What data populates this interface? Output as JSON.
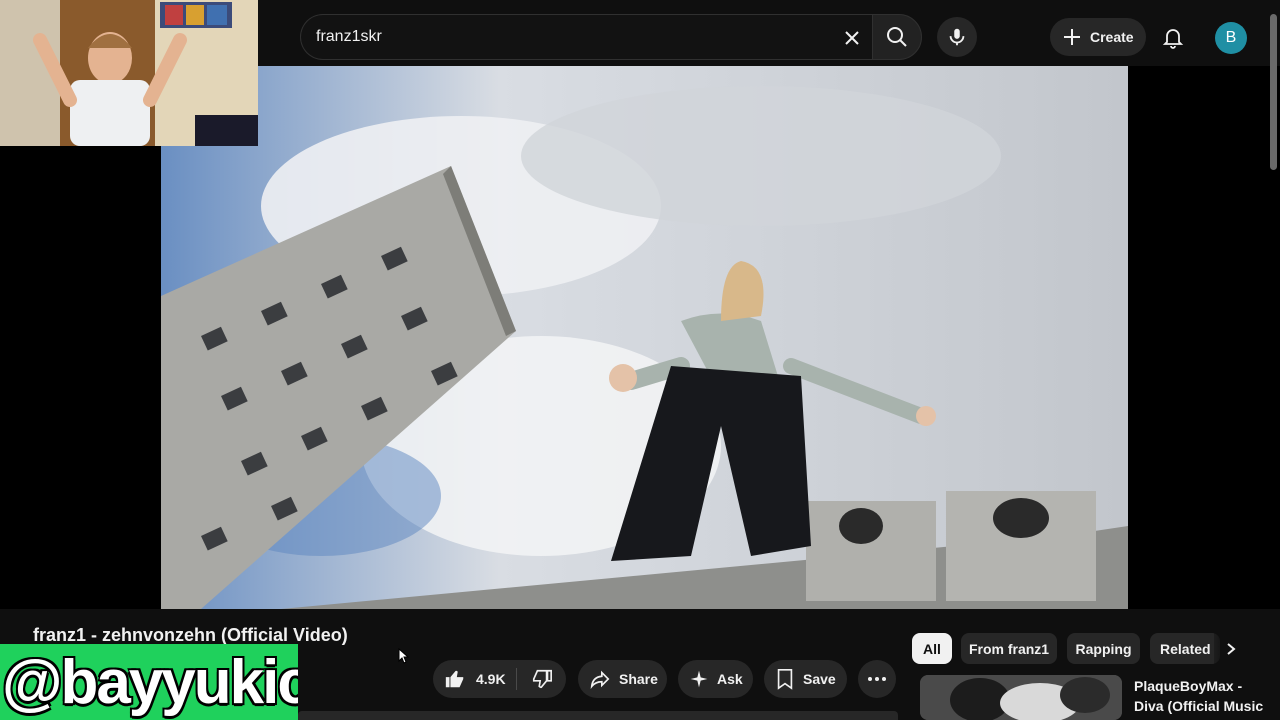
{
  "header": {
    "search_value": "franz1skr",
    "create_label": "Create",
    "avatar_letter": "B",
    "icons": [
      "clear-icon",
      "search-icon",
      "mic-icon",
      "plus-icon",
      "bell-icon"
    ]
  },
  "video": {
    "title": "franz1 - zehnvonzehn (Official Video)",
    "like_count": "4.9K",
    "share_label": "Share",
    "ask_label": "Ask",
    "save_label": "Save"
  },
  "chips": {
    "items": [
      "All",
      "From franz1",
      "Rapping",
      "Related"
    ],
    "active": "All"
  },
  "recommendation": {
    "title": "PlaqueBoyMax - Diva (Official Music Video)"
  },
  "overlay": {
    "watermark": "@bayyukich"
  },
  "colors": {
    "background": "#0f0f0f",
    "button": "#272727",
    "avatar": "#1f8fa4",
    "watermark_bg": "#1fd15c"
  }
}
